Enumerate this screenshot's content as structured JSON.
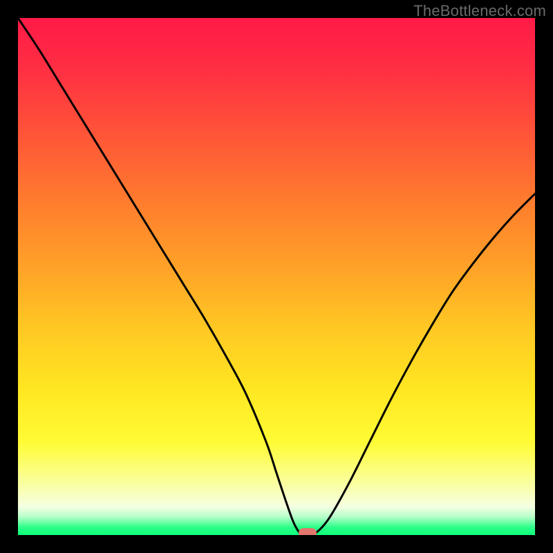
{
  "watermark": "TheBottleneck.com",
  "colors": {
    "frame": "#000000",
    "curve": "#000000",
    "marker": "#e2766c",
    "gradient_stops": [
      {
        "offset": 0.0,
        "color": "#ff1a47"
      },
      {
        "offset": 0.1,
        "color": "#ff2f43"
      },
      {
        "offset": 0.22,
        "color": "#ff5338"
      },
      {
        "offset": 0.35,
        "color": "#ff7a2e"
      },
      {
        "offset": 0.48,
        "color": "#ffa128"
      },
      {
        "offset": 0.6,
        "color": "#ffc823"
      },
      {
        "offset": 0.72,
        "color": "#ffe722"
      },
      {
        "offset": 0.82,
        "color": "#fffb34"
      },
      {
        "offset": 0.9,
        "color": "#faffa0"
      },
      {
        "offset": 0.945,
        "color": "#f5ffe2"
      },
      {
        "offset": 0.965,
        "color": "#b7ffc9"
      },
      {
        "offset": 0.985,
        "color": "#2bff88"
      },
      {
        "offset": 1.0,
        "color": "#0eff79"
      }
    ]
  },
  "chart_data": {
    "type": "line",
    "title": "",
    "xlabel": "",
    "ylabel": "",
    "xlim": [
      0,
      100
    ],
    "ylim": [
      0,
      100
    ],
    "x": [
      0,
      4,
      8,
      12,
      16,
      20,
      24,
      28,
      32,
      36,
      40,
      44,
      48,
      50,
      52,
      53.5,
      55,
      57,
      60,
      64,
      68,
      72,
      76,
      80,
      84,
      88,
      92,
      96,
      100
    ],
    "values": [
      100,
      94,
      87.5,
      81,
      74.5,
      68,
      61.5,
      55,
      48.5,
      42,
      35,
      27.5,
      18,
      12,
      6,
      2,
      0,
      0,
      3,
      10,
      18,
      26,
      33.5,
      40.5,
      47,
      52.5,
      57.5,
      62,
      66
    ],
    "marker": {
      "x": 56,
      "y": 0
    },
    "annotations": []
  }
}
